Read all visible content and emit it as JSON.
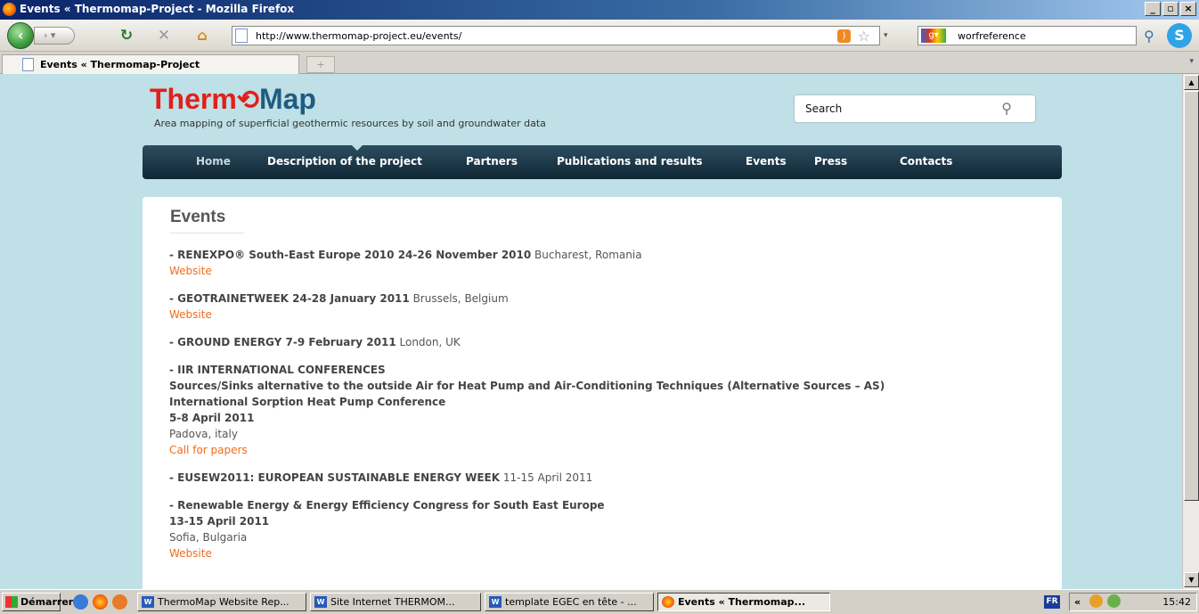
{
  "window": {
    "title": "Events « Thermomap-Project - Mozilla Firefox",
    "min_glyph": "_",
    "max_glyph": "▫",
    "close_glyph": "×"
  },
  "toolbar": {
    "url": "http://www.thermomap-project.eu/events/",
    "search_value": "worfreference",
    "search_engine_icon": "google-icon"
  },
  "tabs": [
    {
      "label": "Events « Thermomap-Project"
    }
  ],
  "site": {
    "logo_part1": "Therm",
    "logo_part2": "Map",
    "tagline": "Area mapping of superficial geothermic resources by soil and groundwater data",
    "search_placeholder": "Search",
    "nav": [
      "Home",
      "Description of the project",
      "Partners",
      "Publications and results",
      "Events",
      "Press",
      "Contacts"
    ]
  },
  "page": {
    "title": "Events",
    "events": [
      {
        "bold": "- RENEXPO® South-East Europe 2010 24-26 November 2010",
        "rest": " Bucharest, Romania",
        "link": "Website"
      },
      {
        "bold": "- GEOTRAINETWEEK 24-28 January 2011",
        "rest": " Brussels, Belgium",
        "link": "Website"
      },
      {
        "bold": "- GROUND ENERGY 7-9 February 2011",
        "rest": " London, UK"
      },
      {
        "line1": "- IIR INTERNATIONAL CONFERENCES",
        "line2": "Sources/Sinks alternative to the outside Air for Heat Pump and Air-Conditioning Techniques (Alternative Sources – AS)",
        "line3": "International Sorption Heat Pump Conference",
        "line4": "5-8 April 2011",
        "place": "Padova, italy",
        "link": "Call for papers"
      },
      {
        "bold": "- EUSEW2011: EUROPEAN SUSTAINABLE ENERGY WEEK",
        "rest": " 11-15 April 2011"
      },
      {
        "line1": "- Renewable Energy & Energy Efficiency Congress for South East Europe",
        "line2": "13-15 April 2011",
        "place": "Sofia, Bulgaria",
        "link": "Website"
      }
    ]
  },
  "taskbar": {
    "start": "Démarrer",
    "buttons": [
      "ThermoMap Website Rep...",
      "Site Internet THERMOM...",
      "template EGEC en tête - ...",
      "Events « Thermomap..."
    ],
    "lang": "FR",
    "tray_chevron": "«",
    "clock": "15:42"
  }
}
